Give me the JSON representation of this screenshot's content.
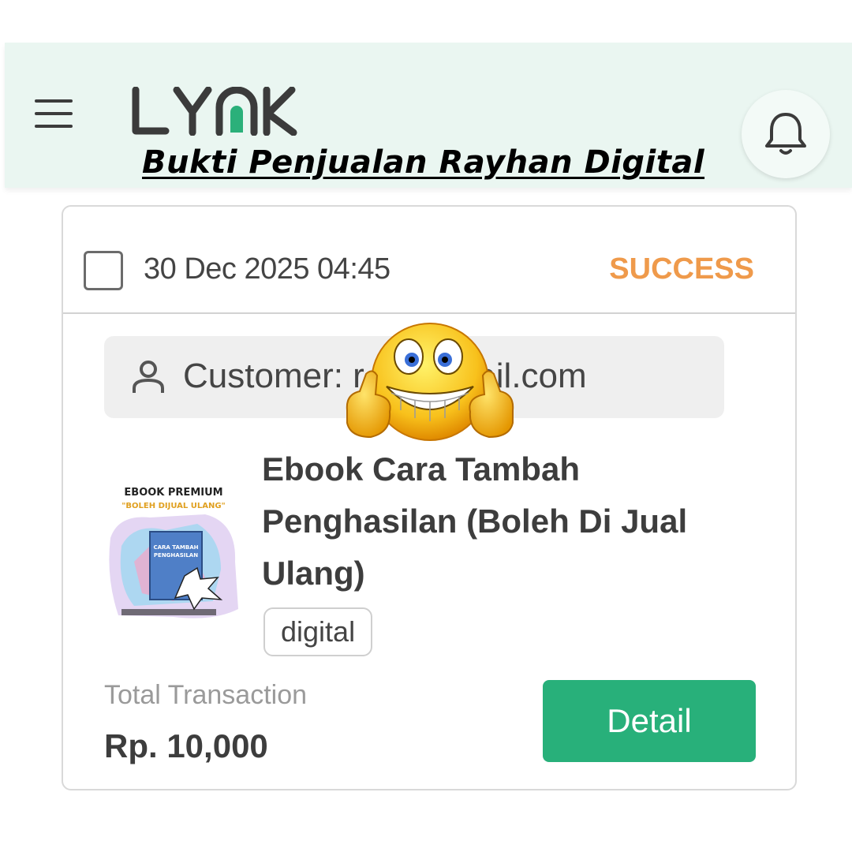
{
  "header": {
    "brand": "LYNK",
    "menu_icon": "hamburger-menu-icon",
    "notification_icon": "bell-icon",
    "overlay_title": "Bukti Penjualan Rayhan Digital "
  },
  "transaction": {
    "date": "30 Dec 2025 04:45",
    "status": "SUCCESS",
    "customer": "Customer: r                    d@gmail.com",
    "product_title": "Ebook Cara Tambah Penghasilan (Boleh Di Jual Ulang)",
    "tag": "digital",
    "total_label": "Total Transaction",
    "total_value": "Rp. 10,000",
    "detail_label": "Detail",
    "thumbnail_text": {
      "line1": "EBOOK PREMIUM",
      "line2": "\"BOLEH DIJUAL ULANG\"",
      "cover_line1": "CARA TAMBAH",
      "cover_line2": "PENGHASILAN"
    }
  },
  "colors": {
    "header_bg": "#eaf6f1",
    "status": "#ef9a4b",
    "detail_button": "#28b07a",
    "logo_accent": "#2bb07a"
  }
}
